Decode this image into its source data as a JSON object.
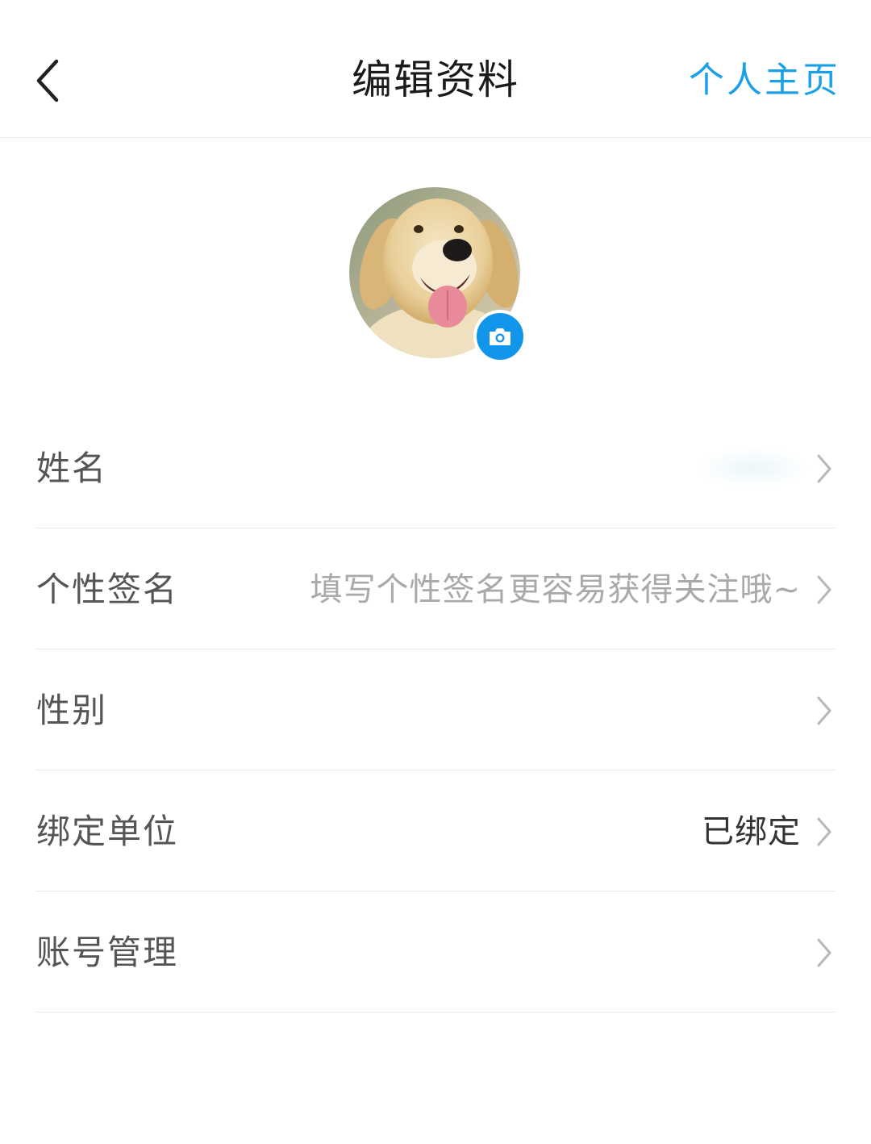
{
  "header": {
    "back_icon": "chevron-left-icon",
    "title": "编辑资料",
    "profile_link": "个人主页",
    "accent_color": "#1aa0e8"
  },
  "avatar": {
    "image": "dog-photo",
    "camera_icon": "camera-icon",
    "badge_color": "#1296ec"
  },
  "rows": [
    {
      "label": "姓名",
      "value": ""
    },
    {
      "label": "个性签名",
      "placeholder": "填写个性签名更容易获得关注哦~"
    },
    {
      "label": "性别",
      "value": ""
    },
    {
      "label": "绑定单位",
      "value": "已绑定"
    },
    {
      "label": "账号管理",
      "value": ""
    }
  ],
  "row_icon": "chevron-right-icon"
}
